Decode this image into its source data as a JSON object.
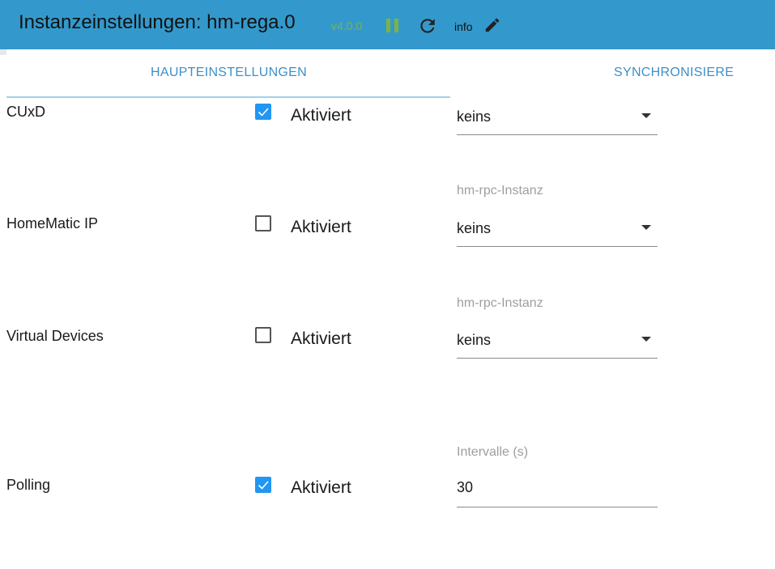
{
  "header": {
    "title": "Instanzeinstellungen: hm-rega.0",
    "version": "v4.0.0",
    "info_label": "info"
  },
  "tabs": [
    {
      "label": "HAUPTEINSTELLUNGEN",
      "active": true
    },
    {
      "label": "SYNCHRONISIERE",
      "active": false
    }
  ],
  "rows": [
    {
      "label": "CUxD",
      "checked": true,
      "checkbox_label": "Aktiviert",
      "field_label": "",
      "field_value": "keins",
      "field_type": "select"
    },
    {
      "label": "HomeMatic IP",
      "checked": false,
      "checkbox_label": "Aktiviert",
      "field_label": "hm-rpc-Instanz",
      "field_value": "keins",
      "field_type": "select"
    },
    {
      "label": "Virtual Devices",
      "checked": false,
      "checkbox_label": "Aktiviert",
      "field_label": "hm-rpc-Instanz",
      "field_value": "keins",
      "field_type": "select"
    },
    {
      "label": "Polling",
      "checked": true,
      "checkbox_label": "Aktiviert",
      "field_label": "Intervalle (s)",
      "field_value": "30",
      "field_type": "input"
    }
  ],
  "colors": {
    "header_bg": "#3399CC",
    "accent": "#2196f3",
    "tab_text": "#3d8fc9",
    "version": "#7cb342"
  },
  "icons": [
    "pause-icon",
    "reload-icon",
    "edit-icon",
    "check-icon",
    "dropdown-arrow-icon"
  ]
}
